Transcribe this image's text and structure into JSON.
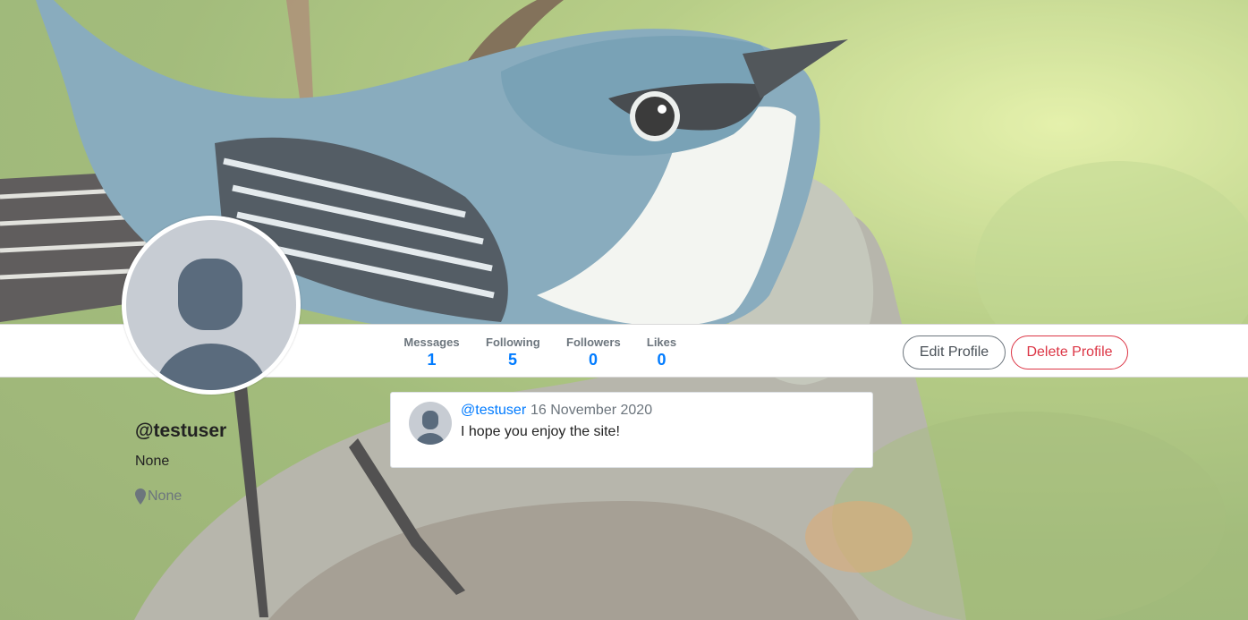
{
  "profile": {
    "username": "@testuser",
    "bio": "None",
    "location": "None"
  },
  "stats": [
    {
      "label": "Messages",
      "value": "1"
    },
    {
      "label": "Following",
      "value": "5"
    },
    {
      "label": "Followers",
      "value": "0"
    },
    {
      "label": "Likes",
      "value": "0"
    }
  ],
  "buttons": {
    "edit": "Edit Profile",
    "delete": "Delete Profile"
  },
  "message": {
    "user": "@testuser",
    "date": "16 November 2020",
    "text": "I hope you enjoy the site!"
  },
  "icons": {
    "location": "map-pin-icon",
    "avatar": "default-user-avatar"
  },
  "colors": {
    "link": "#007bff",
    "danger": "#dc3545",
    "secondary": "#6c757d"
  }
}
